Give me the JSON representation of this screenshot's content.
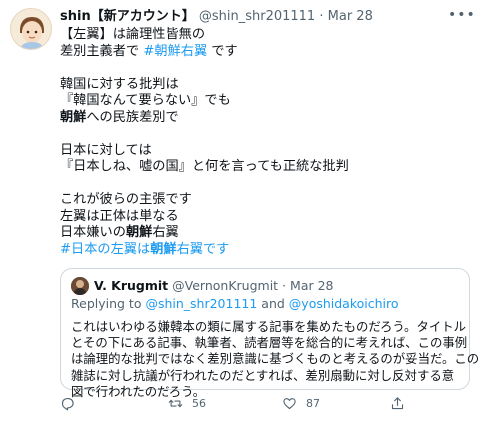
{
  "tweet": {
    "author_name": "shin【新アカウント】",
    "handle": "@shin_shr201111",
    "separator": "·",
    "date": "Mar 28",
    "lines": [
      {
        "parts": [
          {
            "text": "【左翼】は論理性皆無の"
          }
        ]
      },
      {
        "parts": [
          {
            "text": "差別主義者で "
          },
          {
            "text": "#朝鮮右翼",
            "hashtag": true
          },
          {
            "text": " です"
          }
        ]
      },
      {
        "blank": true
      },
      {
        "parts": [
          {
            "text": "韓国に対する批判は"
          }
        ]
      },
      {
        "parts": [
          {
            "text": "『韓国なんて要らない』でも"
          }
        ]
      },
      {
        "parts": [
          {
            "text": "朝鮮",
            "bold": true
          },
          {
            "text": "への民族差別で"
          }
        ]
      },
      {
        "blank": true
      },
      {
        "parts": [
          {
            "text": "日本に対しては"
          }
        ]
      },
      {
        "parts": [
          {
            "text": "『日本しね、嘘の国』と何を言っても正統な批判"
          }
        ]
      },
      {
        "blank": true
      },
      {
        "parts": [
          {
            "text": "これが彼らの主張です"
          }
        ]
      },
      {
        "parts": [
          {
            "text": "左翼は正体は単なる"
          }
        ]
      },
      {
        "parts": [
          {
            "text": "日本嫌いの"
          },
          {
            "text": "朝鮮",
            "bold": true
          },
          {
            "text": "右翼"
          }
        ]
      },
      {
        "parts": [
          {
            "text": "#日本の左翼",
            "hashtag": true
          },
          {
            "text": "は",
            "hashtag": true
          },
          {
            "text": "朝鮮",
            "hashtag": true,
            "bold": true
          },
          {
            "text": "右翼です",
            "hashtag": true
          }
        ]
      }
    ]
  },
  "quote": {
    "author_name": "V. Krugmit",
    "handle": "@VernonKrugmit",
    "separator": "·",
    "date": "Mar 28",
    "replying_prefix": "Replying to ",
    "replying_mention_1": "@shin_shr201111",
    "replying_and": " and ",
    "replying_mention_2": "@yoshidakoichiro",
    "lines": [
      "これはいわゆる嫌韓本の類に属する記事を集めたものだろう。タイトル",
      "とその下にある記事、執筆者、読者層等を総合的に考えれば、この事例",
      "は論理的な批判ではなく差別意識に基づくものと考えるのが妥当だ。この",
      "雑誌に対し抗議が行われたのだとすれば、差別扇動に対し反対する意",
      "図で行われたのだろう。"
    ]
  },
  "actions": {
    "reply_count": "",
    "retweet_count": "56",
    "like_count": "87",
    "share_count": ""
  },
  "icons": {
    "more": "more-horizontal-icon",
    "reply": "reply-icon",
    "retweet": "retweet-icon",
    "like": "heart-icon",
    "share": "share-icon"
  },
  "colors": {
    "link": "#1d9bf0",
    "secondary_text": "#536471",
    "border": "#cfd9de"
  }
}
